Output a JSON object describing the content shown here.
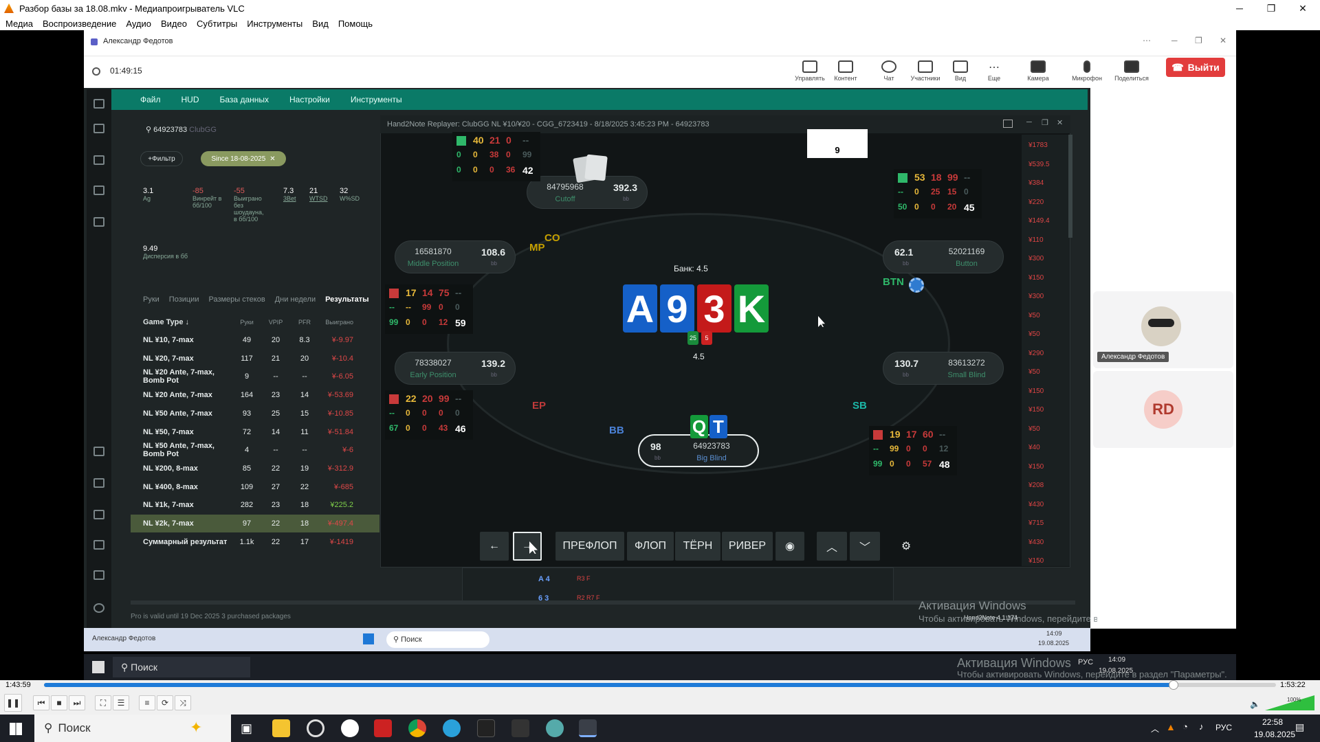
{
  "vlc": {
    "title": "Разбор базы за 18.08.mkv - Медиапроигрыватель VLC",
    "menu": [
      "Медиа",
      "Воспроизведение",
      "Аудио",
      "Видео",
      "Субтитры",
      "Инструменты",
      "Вид",
      "Помощь"
    ],
    "time_elapsed": "1:43:59",
    "time_total": "1:53:22",
    "progress": 0.917,
    "volume": "100%"
  },
  "meeting": {
    "host_name": "Александр Федотов",
    "timer": "01:49:15",
    "tools": [
      "Управлять",
      "Контент",
      "Чат",
      "Участники",
      "Вид",
      "Еще",
      "Камера",
      "Микрофон",
      "Поделиться"
    ],
    "leave_label": "Выйти",
    "participant_1": "Александр Федотов",
    "participant_2_initials": "RD"
  },
  "h2n": {
    "menu": [
      "Файл",
      "HUD",
      "База данных",
      "Настройки",
      "Инструменты"
    ],
    "player_id": "64923783",
    "player_site": "ClubGG",
    "filter_label": "Фильтр",
    "date_filter": "Since 18-08-2025",
    "stats": [
      {
        "v": "3.1",
        "l": "Ag"
      },
      {
        "v": "-85",
        "l": "Винрейт в бб/100"
      },
      {
        "v": "-55",
        "l": "Выиграно без шоудауна, в бб/100"
      },
      {
        "v": "7.3",
        "l": "3Bet"
      },
      {
        "v": "21",
        "l": "WTSD"
      },
      {
        "v": "32",
        "l": "W%SD"
      }
    ],
    "dispersion_value": "9.49",
    "dispersion_label": "Дисперсия в бб",
    "tabs": [
      "Руки",
      "Позиции",
      "Размеры стеков",
      "Дни недели",
      "Результаты"
    ],
    "col_headers": [
      "Game Type ↓",
      "Руки",
      "VPIP",
      "PFR",
      "Выиграно"
    ],
    "rows": [
      {
        "g": "NL ¥10, 7-max",
        "h": "49",
        "v": "20",
        "p": "8.3",
        "w": "¥-9.97"
      },
      {
        "g": "NL ¥20, 7-max",
        "h": "117",
        "v": "21",
        "p": "20",
        "w": "¥-10.4"
      },
      {
        "g": "NL ¥20 Ante, 7-max, Bomb Pot",
        "h": "9",
        "v": "--",
        "p": "--",
        "w": "¥-6.05"
      },
      {
        "g": "NL ¥20 Ante, 7-max",
        "h": "164",
        "v": "23",
        "p": "14",
        "w": "¥-53.69"
      },
      {
        "g": "NL ¥50 Ante, 7-max",
        "h": "93",
        "v": "25",
        "p": "15",
        "w": "¥-10.85"
      },
      {
        "g": "NL ¥50, 7-max",
        "h": "72",
        "v": "14",
        "p": "11",
        "w": "¥-51.84"
      },
      {
        "g": "NL ¥50 Ante, 7-max, Bomb Pot",
        "h": "4",
        "v": "--",
        "p": "--",
        "w": "¥-6"
      },
      {
        "g": "NL ¥200, 8-max",
        "h": "85",
        "v": "22",
        "p": "19",
        "w": "¥-312.9"
      },
      {
        "g": "NL ¥400, 8-max",
        "h": "109",
        "v": "27",
        "p": "22",
        "w": "¥-685"
      },
      {
        "g": "NL ¥1k, 7-max",
        "h": "282",
        "v": "23",
        "p": "18",
        "w": "¥225.2"
      },
      {
        "g": "NL ¥2k, 7-max",
        "h": "97",
        "v": "22",
        "p": "18",
        "w": "¥-497.4"
      },
      {
        "g": "Суммарный результат",
        "h": "1.1k",
        "v": "22",
        "p": "17",
        "w": "¥-1419"
      }
    ],
    "footer": "Pro is valid until 19 Dec 2025   3 purchased packages",
    "version": "Hand2Note 4.1.174"
  },
  "replayer": {
    "title": "Hand2Note Replayer: ClubGG NL ¥10/¥20 - CGG_6723419 - 8/18/2025 3:45:23 PM - 64923783",
    "popup_value": "9",
    "pot_label": "Банк: 4.5",
    "pot_value": "4.5",
    "chip_a": "25",
    "chip_b": "5",
    "board": [
      {
        "r": "A",
        "c": "#1560c8"
      },
      {
        "r": "9",
        "c": "#1560c8"
      },
      {
        "r": "3",
        "c": "#c41a1a"
      },
      {
        "r": "K",
        "c": "#149a3a"
      }
    ],
    "hero_cards": [
      {
        "r": "Q",
        "c": "#149a3a"
      },
      {
        "r": "T",
        "c": "#1560c8"
      }
    ],
    "seats": {
      "cutoff": {
        "id": "84795968",
        "stack": "392.3",
        "pos": "Cutoff"
      },
      "middle": {
        "id": "16581870",
        "stack": "108.6",
        "pos": "Middle Position"
      },
      "early": {
        "id": "78338027",
        "stack": "139.2",
        "pos": "Early Position"
      },
      "button": {
        "id": "52021169",
        "stack": "62.1",
        "pos": "Button"
      },
      "small": {
        "id": "83613272",
        "stack": "130.7",
        "pos": "Small Blind"
      },
      "hero": {
        "id": "64923783",
        "stack": "98",
        "pos": "Big Blind"
      }
    },
    "bb_unit": "bb",
    "pos_labels": {
      "co": "CO",
      "mp": "MP",
      "ep": "EP",
      "btn": "BTN",
      "sb": "SB",
      "bb": "BB"
    },
    "controls": [
      "ПРЕФЛОП",
      "ФЛОП",
      "ТЁРН",
      "РИВЕР"
    ],
    "right_column": [
      "¥1783",
      "¥539.5",
      "¥384",
      "¥220",
      "¥149.4",
      "¥110",
      "¥300",
      "¥150",
      "¥300",
      "¥50",
      "¥50",
      "¥290",
      "¥50",
      "¥150",
      "¥150",
      "¥50",
      "¥40",
      "¥150",
      "¥208",
      "¥430",
      "¥715",
      "¥430",
      "¥150"
    ],
    "hud_cutoff": [
      "40",
      "21",
      "0",
      "--",
      "0",
      "0",
      "38",
      "0",
      "99",
      "0",
      "0",
      "0",
      "36",
      "42"
    ],
    "hud_button": [
      "53",
      "18",
      "99",
      "--",
      "--",
      "0",
      "25",
      "15",
      "0",
      "50",
      "0",
      "0",
      "20",
      "45"
    ],
    "hud_mp": [
      "17",
      "14",
      "75",
      "--",
      "--",
      "--",
      "99",
      "0",
      "0",
      "99",
      "0",
      "0",
      "12",
      "59"
    ],
    "hud_ep": [
      "22",
      "20",
      "99",
      "--",
      "--",
      "0",
      "0",
      "0",
      "0",
      "67",
      "0",
      "0",
      "43",
      "46"
    ],
    "hud_sb": [
      "19",
      "17",
      "60",
      "--",
      "--",
      "99",
      "0",
      "0",
      "12",
      "99",
      "0",
      "0",
      "57",
      "48"
    ],
    "below_rows": [
      {
        "c": "A 4",
        "a": "R3 F"
      },
      {
        "c": "6 3",
        "a": "R2 R7 F"
      }
    ]
  },
  "inner_taskbar": {
    "search": "Поиск",
    "time": "14:09",
    "date": "19.08.2025"
  },
  "outer_taskbar": {
    "search": "Поиск",
    "time": "14:09",
    "date": "19.08.2025",
    "lang": "РУС"
  },
  "activation": {
    "line1": "Активация Windows",
    "line2": "Чтобы активировать Windows, перейдите в раздел \"Параметры\"."
  },
  "windows": {
    "search": "Поиск",
    "time": "22:58",
    "date": "19.08.2025",
    "lang": "РУС"
  }
}
